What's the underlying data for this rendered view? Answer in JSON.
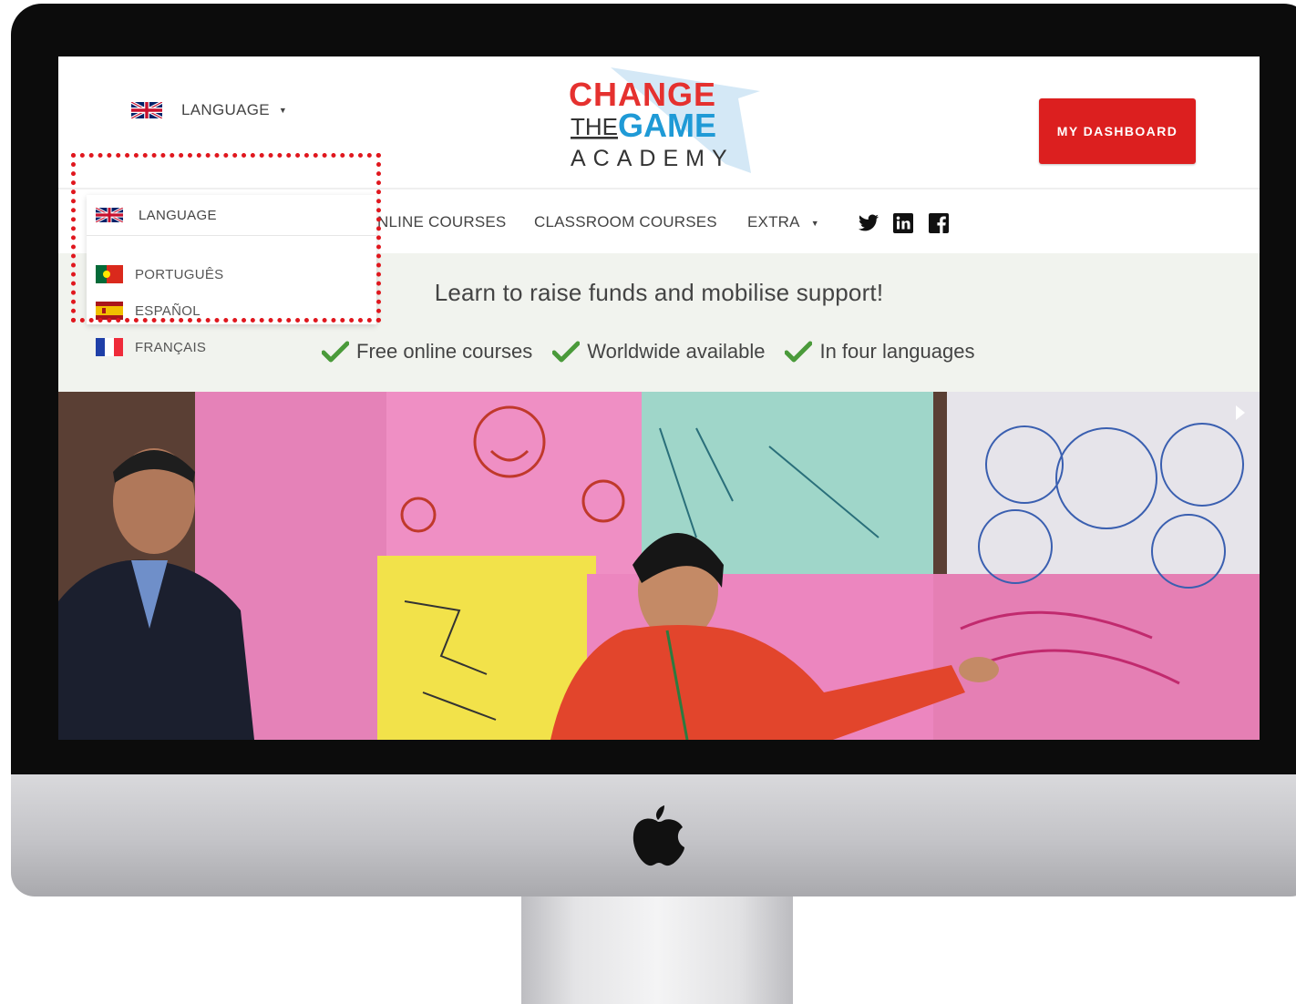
{
  "header": {
    "language_label": "LANGUAGE",
    "logo": {
      "line1": "CHANGE",
      "line2a": "THE",
      "line2b": "GAME",
      "line3": "ACADEMY"
    },
    "dashboard_label": "MY DASHBOARD",
    "dashboard_color": "#dc1f1f"
  },
  "nav": {
    "items": [
      {
        "label": "NLINE COURSES"
      },
      {
        "label": "CLASSROOM COURSES"
      },
      {
        "label": "EXTRA"
      }
    ],
    "social": [
      "twitter-icon",
      "linkedin-icon",
      "facebook-icon"
    ]
  },
  "hero": {
    "tagline": "Learn to raise funds and mobilise support!",
    "features": [
      "Free online courses",
      "Worldwide available",
      "In four languages"
    ],
    "check_color": "#4a9a3a",
    "band_color": "#f1f3ee"
  },
  "language_dropdown": {
    "header_label": "LANGUAGE",
    "options": [
      {
        "label": "PORTUGUÊS",
        "flag": "portugal-flag"
      },
      {
        "label": "ESPAÑOL",
        "flag": "spain-flag"
      },
      {
        "label": "FRANÇAIS",
        "flag": "france-flag"
      }
    ],
    "highlight_color": "#e0171e"
  }
}
